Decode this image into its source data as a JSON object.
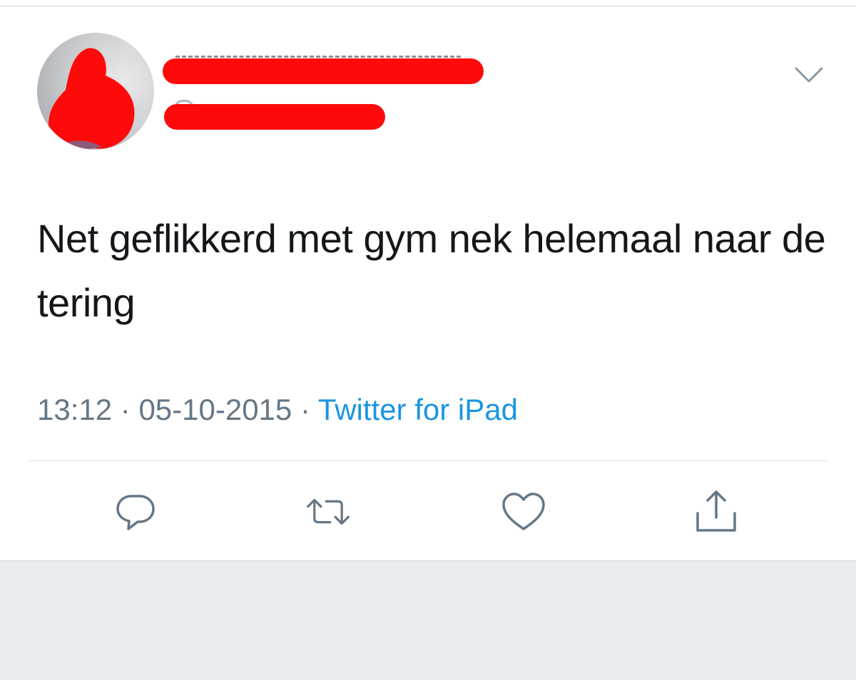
{
  "tweet": {
    "author_name": "",
    "author_handle": "",
    "text": "Net geflikkerd met gym nek helemaal naar de tering",
    "time": "13:12",
    "separator": " · ",
    "date": "05-10-2015",
    "source": "Twitter for iPad"
  },
  "icons": {
    "menu": "chevron-down-icon",
    "reply": "reply-icon",
    "retweet": "retweet-icon",
    "like": "heart-icon",
    "share": "share-icon"
  },
  "colors": {
    "text": "#14171a",
    "secondary": "#657786",
    "link": "#1b95e0",
    "icon": "#657786",
    "redaction": "#ff0a0a",
    "background": "#e6ecf0"
  }
}
